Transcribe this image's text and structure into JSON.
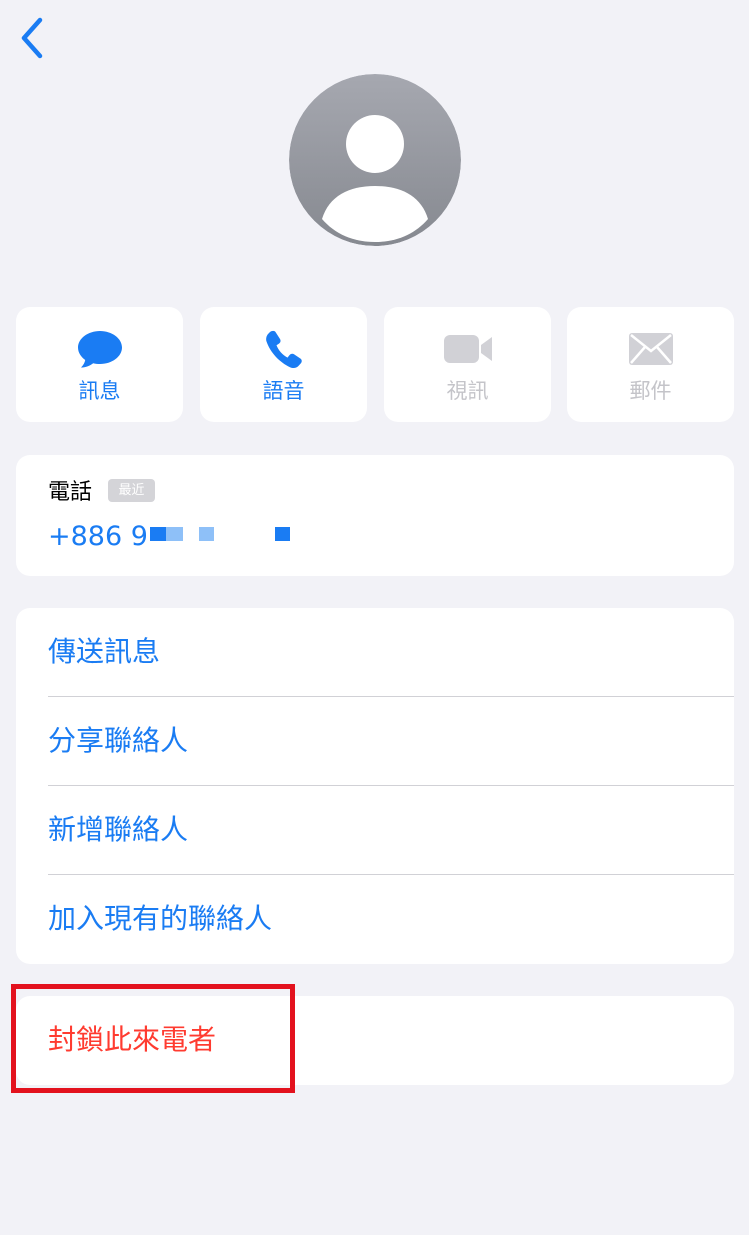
{
  "nav": {
    "back_icon": "chevron-left-icon"
  },
  "avatar": {
    "icon": "person-silhouette-icon"
  },
  "actions": [
    {
      "id": "message",
      "label": "訊息",
      "icon": "message-bubble-icon",
      "enabled": true
    },
    {
      "id": "voice",
      "label": "語音",
      "icon": "phone-icon",
      "enabled": true
    },
    {
      "id": "video",
      "label": "視訊",
      "icon": "video-camera-icon",
      "enabled": false
    },
    {
      "id": "mail",
      "label": "郵件",
      "icon": "envelope-icon",
      "enabled": false
    }
  ],
  "phone": {
    "label": "電話",
    "badge": "最近",
    "number": "+886 9"
  },
  "menu": {
    "items": [
      {
        "label": "傳送訊息"
      },
      {
        "label": "分享聯絡人"
      },
      {
        "label": "新增聯絡人"
      },
      {
        "label": "加入現有的聯絡人"
      }
    ]
  },
  "block": {
    "label": "封鎖此來電者"
  },
  "colors": {
    "accent": "#1a7cf3",
    "destructive": "#ff3b30",
    "background": "#f2f2f7",
    "disabled": "#c4c4c9",
    "highlight": "#e3121e"
  }
}
